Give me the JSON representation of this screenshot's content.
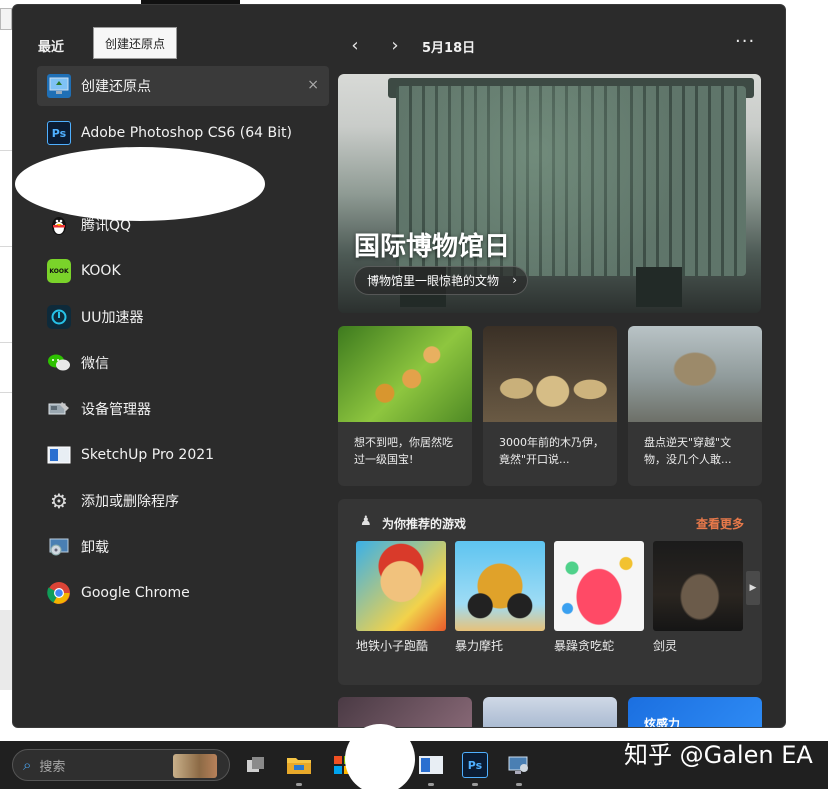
{
  "recent": {
    "header": "最近",
    "tooltip": "创建还原点",
    "items": [
      {
        "label": "创建还原点",
        "icon": "system-restore-icon",
        "selected": true
      },
      {
        "label": "Adobe Photoshop CS6 (64 Bit)",
        "icon": "photoshop-icon",
        "icon_text": "Ps"
      },
      {
        "label": "腾讯QQ",
        "icon": "qq-penguin-icon"
      },
      {
        "label": "KOOK",
        "icon": "kook-icon",
        "icon_text": "KOOK"
      },
      {
        "label": "UU加速器",
        "icon": "uu-accelerator-icon"
      },
      {
        "label": "微信",
        "icon": "wechat-icon"
      },
      {
        "label": "设备管理器",
        "icon": "device-manager-icon"
      },
      {
        "label": "SketchUp Pro 2021",
        "icon": "sketchup-icon"
      },
      {
        "label": "添加或删除程序",
        "icon": "gear-icon",
        "icon_glyph": "⚙"
      },
      {
        "label": "卸载",
        "icon": "uninstall-icon"
      },
      {
        "label": "Google Chrome",
        "icon": "chrome-icon"
      }
    ],
    "close_glyph": "×"
  },
  "header": {
    "prev_glyph": "‹",
    "next_glyph": "›",
    "date": "5月18日",
    "more_glyph": "···"
  },
  "hero": {
    "title": "国际博物馆日",
    "subtitle": "博物馆里一眼惊艳的文物",
    "chevron": "›"
  },
  "news": [
    {
      "text": "想不到吧，你居然吃过一级国宝!"
    },
    {
      "text": "3000年前的木乃伊，竟然\"开口说..."
    },
    {
      "text": "盘点逆天\"穿越\"文物，没几个人敢..."
    }
  ],
  "games": {
    "title": "为你推荐的游戏",
    "see_more": "查看更多",
    "icon_glyph": "♟",
    "scroll_glyph": "▶",
    "items": [
      {
        "name": "地铁小子跑酷"
      },
      {
        "name": "暴力摩托"
      },
      {
        "name": "暴躁贪吃蛇"
      },
      {
        "name": "剑灵"
      }
    ]
  },
  "bottom_cards": [
    {
      "label": ""
    },
    {
      "label": ""
    },
    {
      "label": "炫感力"
    }
  ],
  "taskbar": {
    "search_placeholder": "搜索",
    "search_glyph": "⌕",
    "watermark": "知乎 @Galen EA"
  }
}
